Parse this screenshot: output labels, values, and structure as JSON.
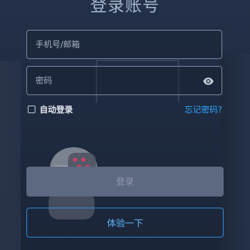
{
  "title": "登录账号",
  "account": {
    "placeholder": "手机号/邮箱"
  },
  "password": {
    "placeholder": "密码",
    "toggle_icon": "eye-icon"
  },
  "options": {
    "auto_login_label": "自动登录",
    "auto_login_checked": false,
    "forgot_password_label": "忘记密码?"
  },
  "buttons": {
    "login_label": "登录",
    "trial_label": "体验一下"
  },
  "colors": {
    "accent": "#33a8ff",
    "disabled_button": "#5d6881"
  }
}
